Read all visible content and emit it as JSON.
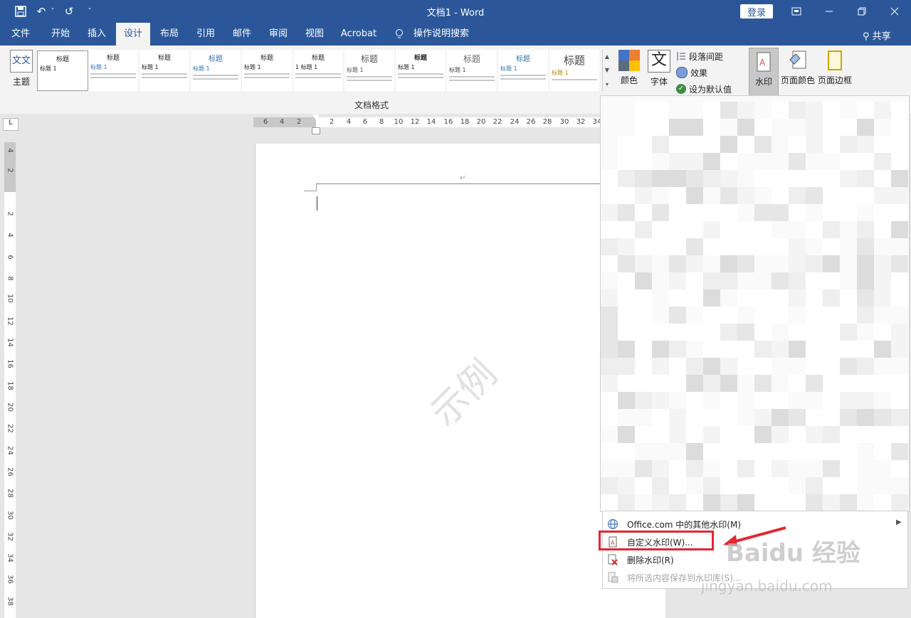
{
  "window": {
    "title": "文档1  -  Word",
    "login_label": "登录",
    "redo_glyph": "↺",
    "undo_glyph": "↶",
    "dropdown_glyph": "ˇ"
  },
  "tabs": [
    {
      "label": "文件"
    },
    {
      "label": "开始"
    },
    {
      "label": "插入"
    },
    {
      "label": "设计"
    },
    {
      "label": "布局"
    },
    {
      "label": "引用"
    },
    {
      "label": "邮件"
    },
    {
      "label": "审阅"
    },
    {
      "label": "视图"
    },
    {
      "label": "Acrobat"
    },
    {
      "label": "操作说明搜索"
    }
  ],
  "share_label": "共享",
  "ribbon": {
    "theme_label": "主题",
    "theme_icon_text": "文文",
    "gallery_label": "文档格式",
    "styles": [
      {
        "heading": "标题",
        "sub": "标题 1"
      },
      {
        "heading": "标题",
        "sub": "标题 1"
      },
      {
        "heading": "标题",
        "sub": "标题 1"
      },
      {
        "heading": "标题",
        "sub": "标题 1"
      },
      {
        "heading": "标题",
        "sub": "标题 1"
      },
      {
        "heading": "标题",
        "sub": "1  标题 1"
      },
      {
        "heading": "标题",
        "sub": "标题 1"
      },
      {
        "heading": "标题",
        "sub": "标题 1"
      },
      {
        "heading": "标题",
        "sub": "标题 1"
      },
      {
        "heading": "标题",
        "sub": "标题 1"
      },
      {
        "heading": "标题",
        "sub": "标题 1"
      }
    ],
    "colors_label": "颜色",
    "fonts_label": "字体",
    "fonts_icon_text": "文",
    "paragraph_spacing_label": "段落间距",
    "effects_label": "效果",
    "set_default_label": "设为默认值",
    "watermark_label": "水印",
    "page_color_label": "页面颜色",
    "page_border_label": "页面边框"
  },
  "ruler": {
    "h_numbers": [
      "6",
      "4",
      "2",
      "2",
      "4",
      "6",
      "8",
      "10",
      "12",
      "14",
      "16",
      "18",
      "20",
      "22",
      "24",
      "26",
      "28",
      "30",
      "32",
      "34"
    ],
    "v_numbers": [
      "4",
      "2",
      "2",
      "4",
      "6",
      "8",
      "10",
      "12",
      "14",
      "16",
      "18",
      "20",
      "22",
      "24",
      "26",
      "28",
      "30",
      "32",
      "34",
      "36",
      "38"
    ],
    "corner_glyph": "L"
  },
  "document": {
    "watermark_text": "示例",
    "para_mark": "↵"
  },
  "watermark_menu": [
    {
      "label": "Office.com 中的其他水印(M)",
      "icon": "globe-icon",
      "has_submenu": true,
      "enabled": true
    },
    {
      "label": "自定义水印(W)...",
      "icon": "custom-watermark-icon",
      "has_submenu": false,
      "enabled": true
    },
    {
      "label": "删除水印(R)",
      "icon": "remove-watermark-icon",
      "has_submenu": false,
      "enabled": true
    },
    {
      "label": "将所选内容保存到水印库(S)...",
      "icon": "save-to-gallery-icon",
      "has_submenu": false,
      "enabled": false
    }
  ],
  "overlay": {
    "baidu_text": "Baidu 经验",
    "baidu_url": "jingyan.baidu.com"
  },
  "colors": {
    "brand": "#2b579a",
    "highlight": "#e3262f"
  }
}
